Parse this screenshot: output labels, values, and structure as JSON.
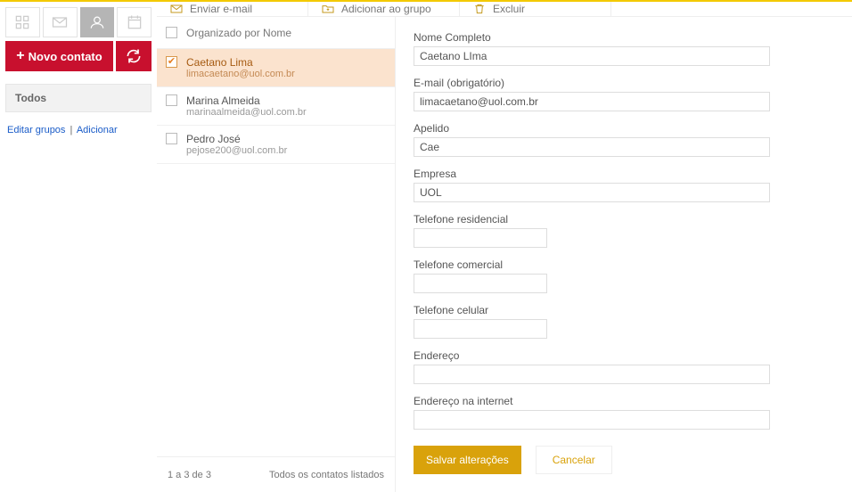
{
  "sidebar": {
    "new_contact_label": "Novo contato",
    "group_all": "Todos",
    "edit_groups": "Editar grupos",
    "add_group": "Adicionar"
  },
  "toolbar": {
    "send_email": "Enviar e-mail",
    "add_to_group": "Adicionar ao grupo",
    "delete": "Excluir"
  },
  "list": {
    "header": "Organizado por Nome",
    "contacts": [
      {
        "name": "Caetano Lima",
        "email": "limacaetano@uol.com.br",
        "selected": true
      },
      {
        "name": "Marina Almeida",
        "email": "marinaalmeida@uol.com.br",
        "selected": false
      },
      {
        "name": "Pedro José",
        "email": "pejose200@uol.com.br",
        "selected": false
      }
    ],
    "range_prefix": "1 a 3",
    "range_suffix": " de 3",
    "footer_right": "Todos os contatos listados"
  },
  "form": {
    "labels": {
      "full_name": "Nome Completo",
      "email": "E-mail (obrigatório)",
      "nickname": "Apelido",
      "company": "Empresa",
      "home_phone": "Telefone residencial",
      "work_phone": "Telefone comercial",
      "mobile_phone": "Telefone celular",
      "address": "Endereço",
      "internet_address": "Endereço na internet"
    },
    "values": {
      "full_name": "Caetano LIma",
      "email": "limacaetano@uol.com.br",
      "nickname": "Cae",
      "company": "UOL",
      "home_phone": "",
      "work_phone": "",
      "mobile_phone": "",
      "address": "",
      "internet_address": ""
    },
    "buttons": {
      "save": "Salvar alterações",
      "cancel": "Cancelar"
    }
  }
}
